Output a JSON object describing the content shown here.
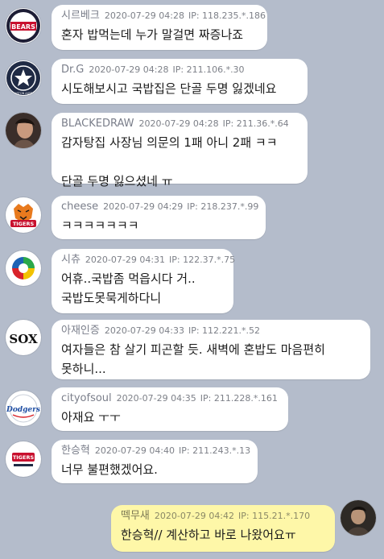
{
  "messages": [
    {
      "name": "시르베크",
      "time": "2020-07-29 04:28",
      "ip": "IP: 118.235.*.186",
      "text": "혼자 밥먹는데 누가 말걸면 짜증나죠",
      "avatar_icon": "bears-logo-icon",
      "avatar_text": "BEARS"
    },
    {
      "name": "Dr.G",
      "time": "2020-07-29 04:28",
      "ip": "IP: 211.106.*.30",
      "text": "시도해보시고 국밥집은 단골 두명 잃겠네요",
      "avatar_icon": "astros-logo-icon",
      "avatar_text": "HOUSTON ASTROS"
    },
    {
      "name": "BLACKEDRAW",
      "time": "2020-07-29 04:28",
      "ip": "IP: 211.36.*.64",
      "text": "감자탕집 사장님 의문의 1패 아니 2패 ㅋㅋ\n\n단골 두명 잃으셨네 ㅠ",
      "avatar_icon": "person-photo-icon"
    },
    {
      "name": "cheese",
      "time": "2020-07-29 04:29",
      "ip": "IP: 218.237.*.99",
      "text": "ㅋㅋㅋㅋㅋㅋㅋ",
      "avatar_icon": "tigers-logo-icon",
      "avatar_text": "TIGERS"
    },
    {
      "name": "시츄",
      "time": "2020-07-29 04:31",
      "ip": "IP: 122.37.*.75",
      "text": "어휴..국밥좀 먹읍시다 거..\n국밥도못묵게하다니",
      "avatar_icon": "colorful-emblem-icon"
    },
    {
      "name": "아재인증",
      "time": "2020-07-29 04:33",
      "ip": "IP: 112.221.*.52",
      "text": "여자들은 참 살기 피곤할 듯. 새벽에 혼밥도 마음편히\n못하니...",
      "avatar_icon": "white-sox-logo-icon",
      "avatar_text": "SOX"
    },
    {
      "name": "cityofsoul",
      "time": "2020-07-29 04:35",
      "ip": "IP: 211.228.*.161",
      "text": "아재요 ㅜㅜ",
      "avatar_icon": "dodgers-logo-icon",
      "avatar_text": "Dodgers"
    },
    {
      "name": "한승혁",
      "time": "2020-07-29 04:40",
      "ip": "IP: 211.243.*.13",
      "text": "너무 불편했겠어요.",
      "avatar_icon": "league-logo-icon",
      "avatar_text": "TIGERS"
    },
    {
      "name": "떽무새",
      "time": "2020-07-29 04:42",
      "ip": "IP: 115.21.*.170",
      "text": "한승혁// 계산하고 바로 나왔어요ㅠ",
      "avatar_icon": "person-photo-icon",
      "mine": true
    }
  ],
  "colors": {
    "background": "#b4bccb",
    "bubble": "#ffffff",
    "my_bubble": "#fef7a8",
    "meta_text": "#7d8088"
  }
}
